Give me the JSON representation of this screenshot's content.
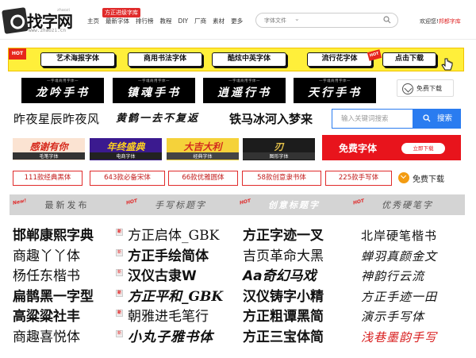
{
  "header": {
    "logo_text": "找字网",
    "logo_sub": "www.zhaozi.cn",
    "logo_tag": "zhaozi",
    "promo_tag": "方正进级字库",
    "nav": [
      "主页",
      "最新字体",
      "排行榜",
      "教程",
      "DIY",
      "厂商",
      "素材",
      "更多"
    ],
    "search_select_label": "字体文件",
    "welcome": "欢迎您!",
    "welcome_brand": "邦都字库"
  },
  "banner": {
    "hot": "HOT",
    "pills": [
      "艺术海报字体",
      "商用书法字体",
      "酷炫中英字体",
      "流行花字体",
      "点击下载"
    ]
  },
  "featured": {
    "top_label": "一字魂商用字体一",
    "items": [
      "龙吟手书",
      "镇魂手书",
      "逍遥行书",
      "天行手书"
    ],
    "free_download": "免费下载"
  },
  "samples": [
    "昨夜星辰昨夜风",
    "黄鹤一去不复返",
    "铁马冰河入梦来"
  ],
  "keyword_search": {
    "placeholder": "输入关键词搜索",
    "button": "搜索"
  },
  "categories": [
    {
      "big": "感谢有你",
      "label": "毛笔字体",
      "bg": "#fbe3d2",
      "color": "#d62b1e",
      "label_bg": "#333333"
    },
    {
      "big": "年终盛典",
      "label": "电商字体",
      "bg": "#3b1a8f",
      "color": "#ffd21e",
      "label_bg": "#222222"
    },
    {
      "big": "大吉大利",
      "label": "经典字体",
      "bg": "#f5d23a",
      "color": "#d22a1e",
      "label_bg": "#444444"
    },
    {
      "big": "刃",
      "label": "图形字体",
      "bg": "#1c1c1c",
      "color": "#e6c24a",
      "label_bg": "#333333"
    }
  ],
  "free_banner": {
    "title": "免费字体",
    "button": "立即下载"
  },
  "tags": [
    "111款经典黑体",
    "643款必备宋体",
    "66款优雅圆体",
    "58款创意隶书体",
    "225款手写体"
  ],
  "free_download2": "免费下载",
  "columns": [
    {
      "title": "最新发布",
      "badge": "New!",
      "rows": [
        "邯郸康熙字典",
        "商趣丫丫体",
        "杨任东楷书",
        "扁鹊黑一字型",
        "高粱粱社丰",
        "商趣喜悦体"
      ]
    },
    {
      "title": "手写标题字",
      "badge": "HOT",
      "rows": [
        "方正启体_GBK",
        "方正手绘简体",
        "汉仪古隶W",
        "方正平和_GBK",
        "朝雅进毛笔行",
        "小丸子雅书体"
      ]
    },
    {
      "title": "创意标题字",
      "badge": "HOT",
      "rows": [
        "方正字迹一叉",
        "吉页革命大黑",
        "Aa奇幻马戏",
        "汉仪铸字小精",
        "方正粗谭黑简",
        "方正三宝体简"
      ]
    },
    {
      "title": "优秀硬笔字",
      "badge": "HOT",
      "rows": [
        "北岸硬笔楷书",
        "蝉羽真颜金文",
        "神韵行云流",
        "方正手迹一田",
        "演示手写体",
        "浅巷墨韵手写"
      ]
    }
  ]
}
